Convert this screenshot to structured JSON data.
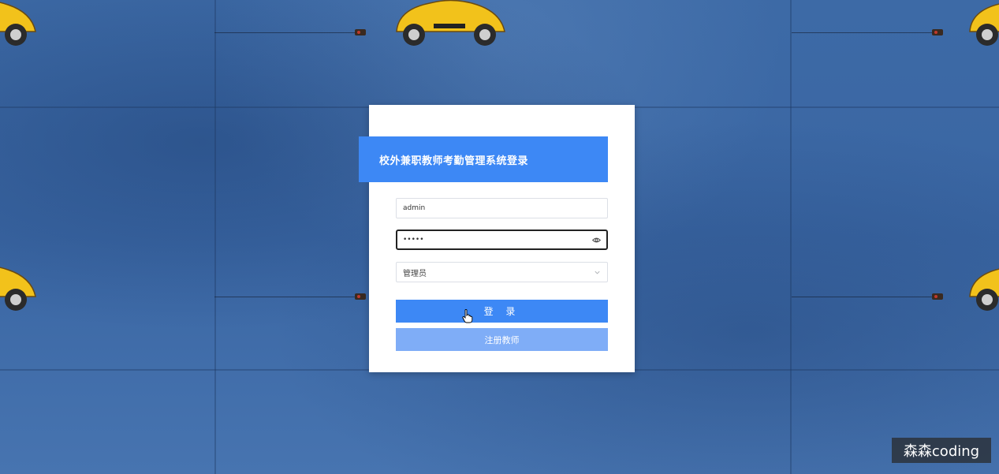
{
  "login": {
    "title": "校外兼职教师考勤管理系统登录",
    "username_value": "admin",
    "password_value": "•••••",
    "role_selected": "管理员",
    "login_button": "登 录",
    "register_button": "注册教师"
  },
  "watermark": {
    "text": "森森coding"
  },
  "icons": {
    "password_toggle": "eye-icon",
    "role_dropdown": "chevron-down-icon",
    "cursor": "hand-pointer-icon"
  },
  "colors": {
    "accent": "#3d88f5",
    "register_button": "#7fadf7",
    "background": "#3d6aa6"
  }
}
